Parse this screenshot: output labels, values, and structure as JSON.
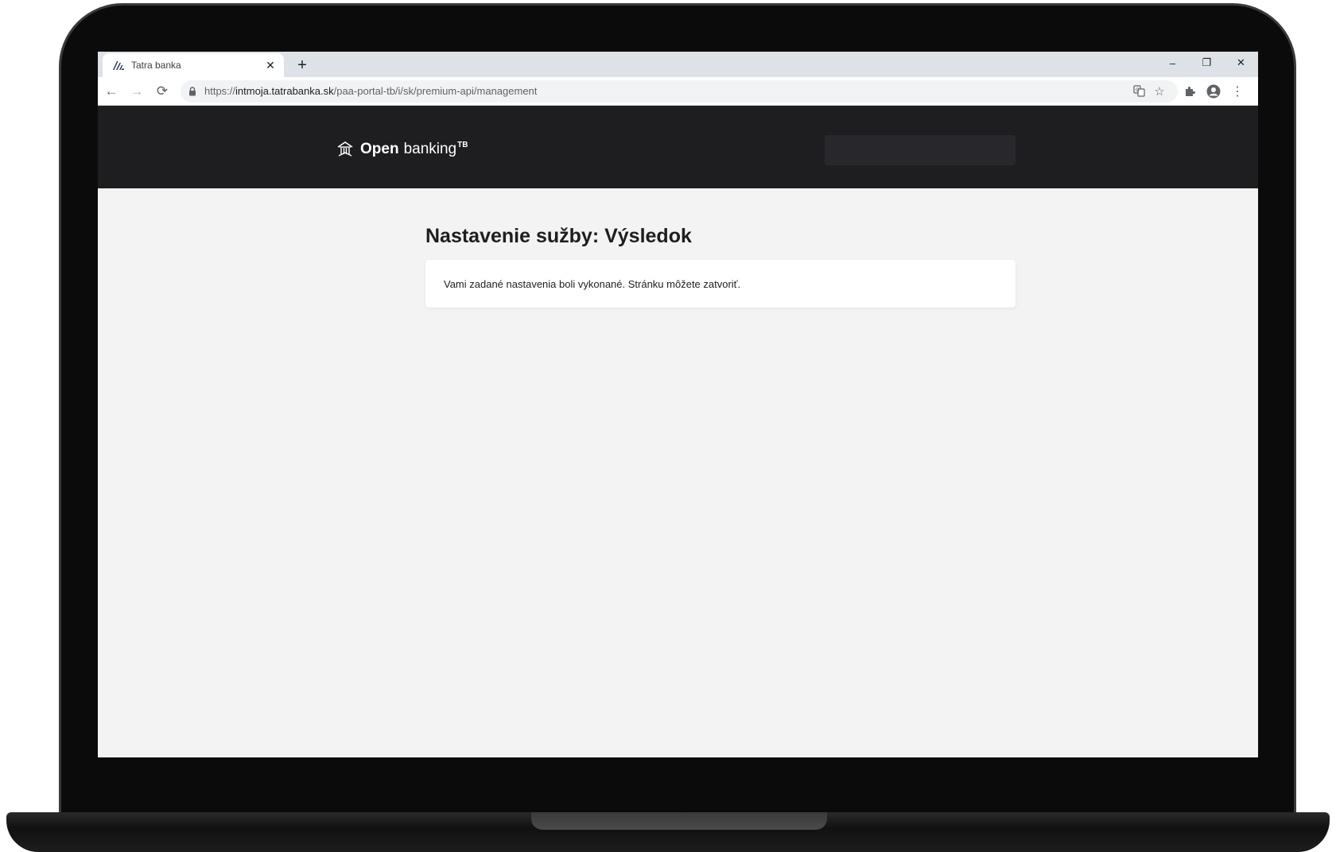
{
  "browser": {
    "tab": {
      "title": "Tatra banka",
      "close_glyph": "✕",
      "favicon": "tatra-banka-logo"
    },
    "new_tab_glyph": "+",
    "window": {
      "minimize": "–",
      "restore": "❐",
      "close": "✕"
    },
    "nav": {
      "back": "←",
      "forward": "→",
      "reload": "⟳"
    },
    "address": {
      "scheme": "https://",
      "host": "intmoja.tatrabanka.sk",
      "path": "/paa-portal-tb/i/sk/premium-api/management"
    },
    "omnibox_icons": {
      "translate": "translate-icon",
      "bookmark": "☆"
    },
    "toolbar_icons": {
      "extensions": "puzzle-icon",
      "profile": "profile-icon",
      "menu": "⋮"
    }
  },
  "site": {
    "brand_open": "Open",
    "brand_banking": "banking",
    "brand_sup": "TB"
  },
  "main": {
    "title": "Nastavenie sužby: Výsledok",
    "message": "Vami zadané nastavenia boli vykonané. Stránku môžete zatvoriť."
  },
  "colors": {
    "header_bg": "#1e1e21",
    "page_bg": "#f3f3f3",
    "card_bg": "#ffffff"
  }
}
